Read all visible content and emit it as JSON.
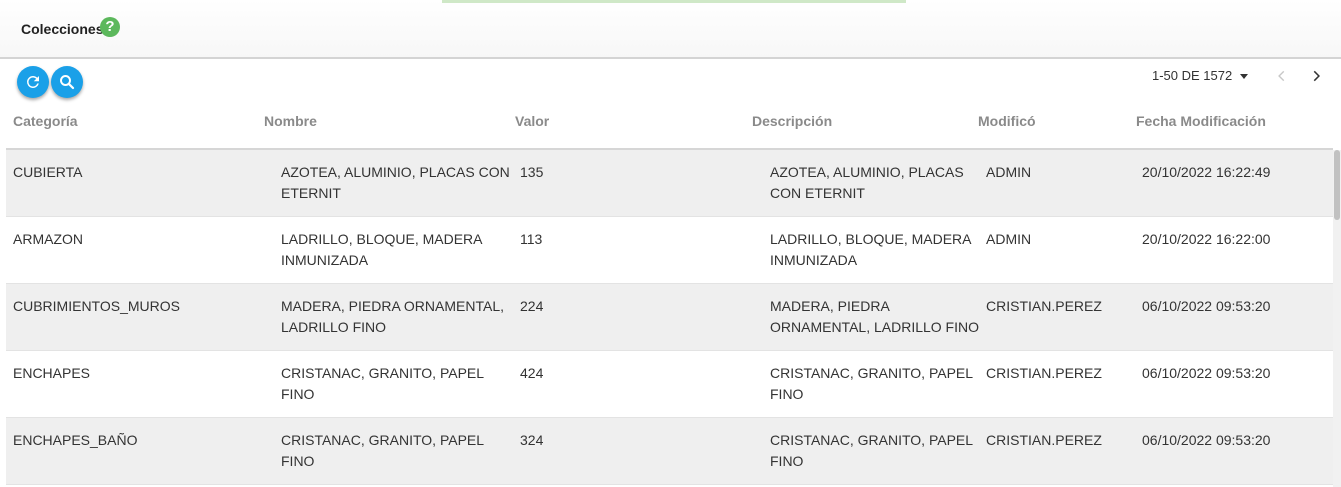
{
  "header": {
    "title": "Colecciones",
    "help_icon": "help-icon"
  },
  "toolbar": {
    "refresh_icon": "refresh-icon",
    "search_icon": "search-icon",
    "accent": "#1aa0e8"
  },
  "pagination": {
    "range_label": "1-50 DE 1572",
    "prev_icon": "chevron-left-icon",
    "next_icon": "chevron-right-icon"
  },
  "table": {
    "columns": [
      "Categoría",
      "Nombre",
      "Valor",
      "Descripción",
      "Modificó",
      "Fecha Modificación"
    ],
    "rows": [
      [
        "CUBIERTA",
        "AZOTEA, ALUMINIO, PLACAS CON ETERNIT",
        "135",
        "AZOTEA, ALUMINIO, PLACAS CON ETERNIT",
        "ADMIN",
        "20/10/2022 16:22:49"
      ],
      [
        "ARMAZON",
        "LADRILLO, BLOQUE, MADERA INMUNIZADA",
        "113",
        "LADRILLO, BLOQUE, MADERA INMUNIZADA",
        "ADMIN",
        "20/10/2022 16:22:00"
      ],
      [
        "CUBRIMIENTOS_MUROS",
        "MADERA, PIEDRA ORNAMENTAL, LADRILLO FINO",
        "224",
        "MADERA, PIEDRA ORNAMENTAL, LADRILLO FINO",
        "CRISTIAN.PEREZ",
        "06/10/2022 09:53:20"
      ],
      [
        "ENCHAPES",
        "CRISTANAC, GRANITO, PAPEL FINO",
        "424",
        "CRISTANAC, GRANITO, PAPEL FINO",
        "CRISTIAN.PEREZ",
        "06/10/2022 09:53:20"
      ],
      [
        "ENCHAPES_BAÑO",
        "CRISTANAC, GRANITO, PAPEL FINO",
        "324",
        "CRISTANAC, GRANITO, PAPEL FINO",
        "CRISTIAN.PEREZ",
        "06/10/2022 09:53:20"
      ]
    ]
  }
}
